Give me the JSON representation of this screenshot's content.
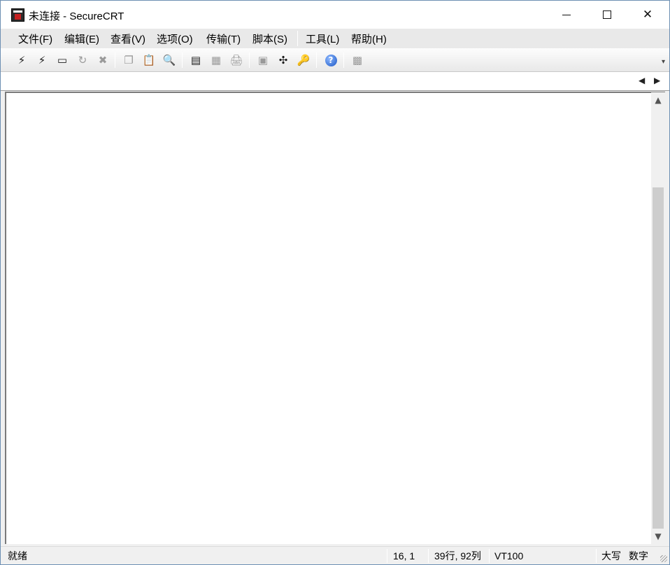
{
  "window": {
    "title": "未连接 - SecureCRT",
    "minimize_icon": "minimize-icon",
    "maximize_icon": "maximize-icon",
    "close_icon": "close-icon",
    "close_glyph": "✕"
  },
  "menubar": {
    "items": [
      {
        "label": "文件(F)"
      },
      {
        "label": "编辑(E)"
      },
      {
        "label": "查看(V)"
      },
      {
        "label": "选项(O)"
      },
      {
        "label": "传输(T)"
      },
      {
        "label": "脚本(S)"
      },
      {
        "label": "工具(L)"
      },
      {
        "label": "帮助(H)"
      }
    ]
  },
  "toolbar": {
    "buttons": [
      {
        "icon": "connect-icon",
        "glyph": "⚡"
      },
      {
        "icon": "quick-connect-icon",
        "glyph": "⚡"
      },
      {
        "icon": "connect-in-tab-icon",
        "glyph": "▭"
      },
      {
        "icon": "reconnect-icon",
        "glyph": "↻"
      },
      {
        "icon": "disconnect-icon",
        "glyph": "✖"
      },
      {
        "icon": "copy-icon",
        "glyph": "❐"
      },
      {
        "icon": "paste-icon",
        "glyph": "📋"
      },
      {
        "icon": "find-icon",
        "glyph": "🔍"
      },
      {
        "icon": "print-screen-icon",
        "glyph": "▤"
      },
      {
        "icon": "print-selection-icon",
        "glyph": "▦"
      },
      {
        "icon": "print-icon",
        "glyph": "🖨"
      },
      {
        "icon": "session-options-icon",
        "glyph": "▣"
      },
      {
        "icon": "global-options-icon",
        "glyph": "✣"
      },
      {
        "icon": "keymap-icon",
        "glyph": "🔑"
      },
      {
        "icon": "help-icon",
        "glyph": "?"
      },
      {
        "icon": "about-icon",
        "glyph": "▩"
      }
    ],
    "overflow_icon": "toolbar-overflow-icon",
    "overflow_glyph": "▾"
  },
  "tabstrip": {
    "left_arrow": "◀",
    "right_arrow": "▶"
  },
  "scrollbar": {
    "up_arrow": "▲",
    "down_arrow": "▼"
  },
  "statusbar": {
    "status": "就绪",
    "cursor_position": "16,  1",
    "dimensions": "39行, 92列",
    "terminal_type": "VT100",
    "caps_lock": "大写",
    "num_lock": "数字"
  },
  "colors": {
    "window_border": "#6d8fb3",
    "terminal_background": "#ffffff",
    "chrome_background": "#f0f0f0"
  }
}
